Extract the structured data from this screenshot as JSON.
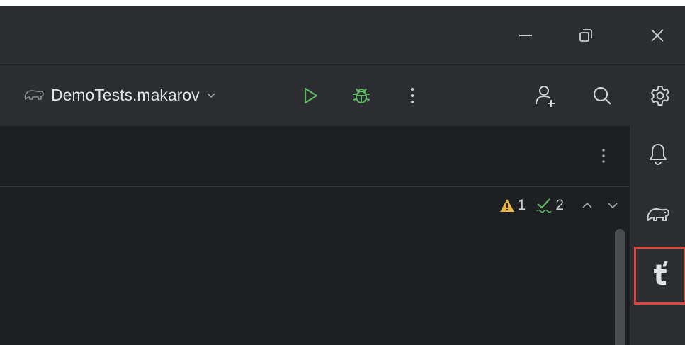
{
  "title_bar": {
    "minimize_icon": "minimize-icon",
    "restore_icon": "restore-icon",
    "close_icon": "close-icon"
  },
  "toolbar": {
    "project_icon": "elephant-icon",
    "project_name": "DemoTests.makarov",
    "dropdown_icon": "chevron-down-icon",
    "run_icon": "run-icon",
    "debug_icon": "bug-icon",
    "more_icon": "more-vertical-icon",
    "add_user_icon": "add-user-icon",
    "search_icon": "search-icon",
    "settings_icon": "gear-icon"
  },
  "editor": {
    "tabs_more_icon": "more-vertical-icon",
    "inspections": {
      "warning_count": "1",
      "typo_count": "2",
      "warning_color": "#e5b53f",
      "typo_color": "#5fb865"
    }
  },
  "right_stripe": {
    "items": [
      {
        "icon": "bell-icon",
        "label": "Notifications"
      },
      {
        "icon": "elephant-icon",
        "label": "Gradle"
      },
      {
        "icon": "t-icon",
        "glyph": "ť",
        "highlighted": true
      }
    ]
  },
  "colors": {
    "run_green": "#5fb865",
    "highlight_red": "#e0443a",
    "icon_gray": "#ced0d6"
  }
}
